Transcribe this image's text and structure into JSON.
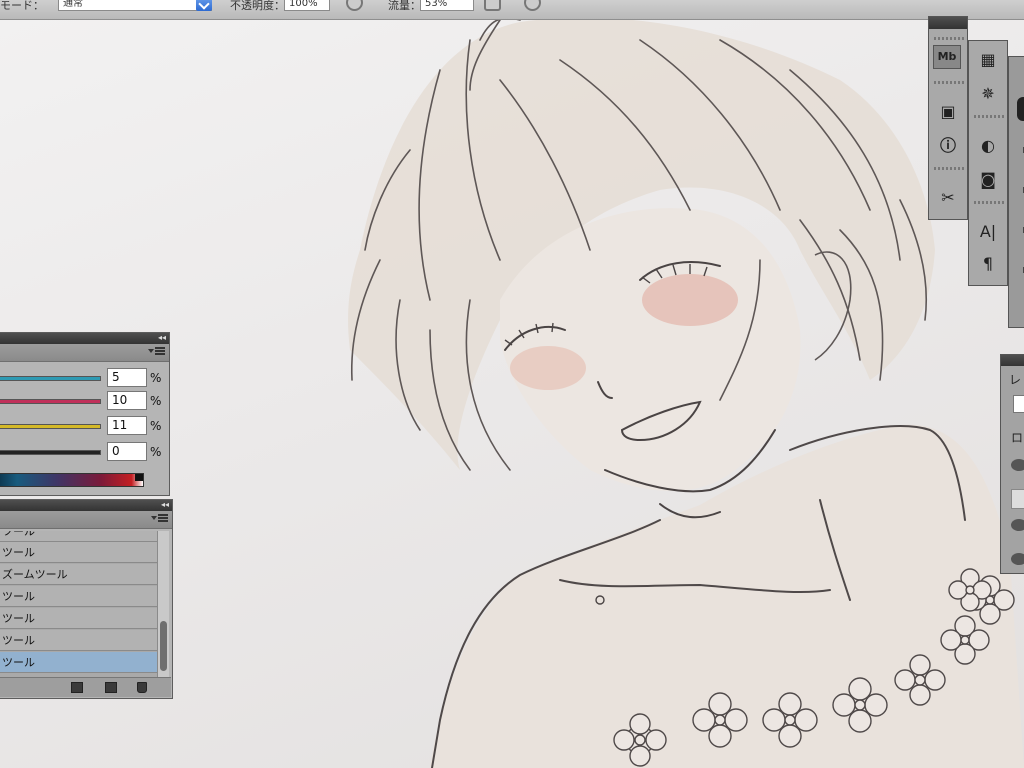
{
  "options_bar": {
    "mode_label": "モード：",
    "mode_value": "通常",
    "opacity_label": "不透明度：",
    "opacity_value": "100%",
    "flow_label": "流量：",
    "flow_value": "53%"
  },
  "color_panel": {
    "rows": [
      {
        "value": "5",
        "unit": "%",
        "color": "#2e9ab3"
      },
      {
        "value": "10",
        "unit": "%",
        "color": "#c0305a"
      },
      {
        "value": "11",
        "unit": "%",
        "color": "#d4b928"
      },
      {
        "value": "0",
        "unit": "%",
        "color": "#222222"
      }
    ]
  },
  "actions_panel": {
    "items": [
      "ツール",
      "ツール",
      "ズームツール",
      "ツール",
      "ツール",
      "ツール",
      "ツール"
    ],
    "selected_index": 6
  },
  "dock": {
    "col1": [
      "mb-icon",
      "image-icon",
      "info-icon",
      "tools-icon"
    ],
    "col2": [
      "grid-icon",
      "compass-icon",
      "adjust-icon",
      "mask-icon",
      "character-icon",
      "paragraph-icon"
    ],
    "col2_labels": {
      "character": "A|",
      "paragraph": "¶"
    },
    "col1_labels": {
      "mb": "Mb"
    },
    "layers_partial_labels": [
      "レ",
      "ロ"
    ]
  }
}
